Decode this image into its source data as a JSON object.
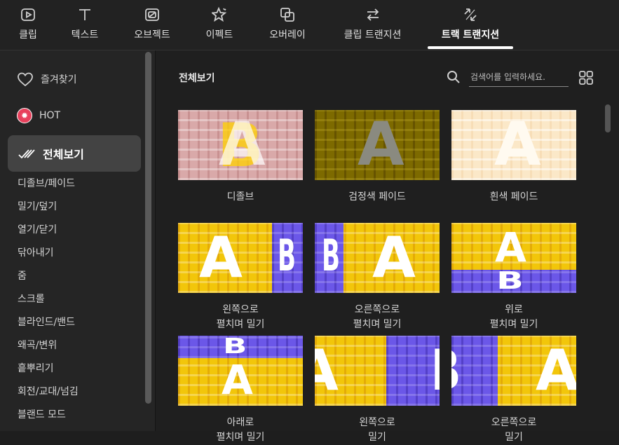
{
  "tabs": [
    {
      "label": "클립",
      "icon": "play-square-icon",
      "active": false
    },
    {
      "label": "텍스트",
      "icon": "text-t-icon",
      "active": false
    },
    {
      "label": "오브젝트",
      "icon": "sticker-icon",
      "active": false
    },
    {
      "label": "이펙트",
      "icon": "star-sparkle-icon",
      "active": false
    },
    {
      "label": "오버레이",
      "icon": "overlay-layers-icon",
      "active": false
    },
    {
      "label": "클립 트랜지션",
      "icon": "swap-arrows-icon",
      "active": false
    },
    {
      "label": "트랙 트랜지션",
      "icon": "diagonal-arrows-icon",
      "active": true
    }
  ],
  "sidebar": {
    "favorites": "즐겨찾기",
    "hot": "HOT",
    "all": "전체보기",
    "categories": [
      "디졸브/페이드",
      "밀기/덮기",
      "열기/닫기",
      "닦아내기",
      "줌",
      "스크롤",
      "블라인드/밴드",
      "왜곡/변위",
      "흩뿌리기",
      "회전/교대/넘김",
      "블랜드 모드"
    ]
  },
  "main": {
    "title": "전체보기",
    "search_placeholder": "검색어를 입력하세요.",
    "items": [
      {
        "line1": "디졸브",
        "line2": ""
      },
      {
        "line1": "검정색 페이드",
        "line2": ""
      },
      {
        "line1": "흰색 페이드",
        "line2": ""
      },
      {
        "line1": "왼쪽으로",
        "line2": "펼치며 밀기"
      },
      {
        "line1": "오른쪽으로",
        "line2": "펼치며 밀기"
      },
      {
        "line1": "위로",
        "line2": "펼치며 밀기"
      },
      {
        "line1": "아래로",
        "line2": "펼치며 밀기"
      },
      {
        "line1": "왼쪽으로",
        "line2": "밀기"
      },
      {
        "line1": "오른쪽으로",
        "line2": "밀기"
      }
    ],
    "thumb_letters": {
      "a": "A",
      "b": "B"
    }
  },
  "colors": {
    "accent_yellow": "#f2c60a",
    "accent_purple": "#6b57e8",
    "active_underline": "#ffffff"
  }
}
